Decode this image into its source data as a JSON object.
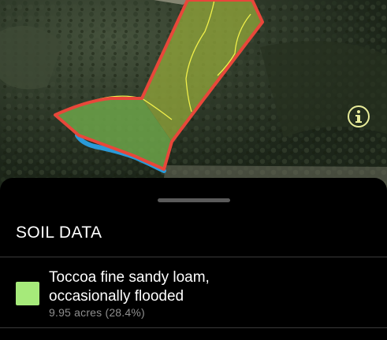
{
  "map": {
    "colors": {
      "terrain_dark": "#1f2a1c",
      "terrain_mid": "#34422d",
      "terrain_light": "#4a5640",
      "field": "#7a7a62",
      "boundary": "#e8473a",
      "soil_unit_a_fill": "#8fa43a",
      "soil_unit_b_fill": "#6fa84a",
      "soil_line": "#f1f04a",
      "stream": "#2a9ad8"
    }
  },
  "sheet": {
    "title": "SOIL DATA",
    "items": [
      {
        "name_line1": "Toccoa fine sandy loam,",
        "name_line2": "occasionally flooded",
        "meta": "9.95 acres (28.4%)",
        "swatch_color": "#a6ea7a",
        "icon": "info-icon"
      }
    ]
  }
}
